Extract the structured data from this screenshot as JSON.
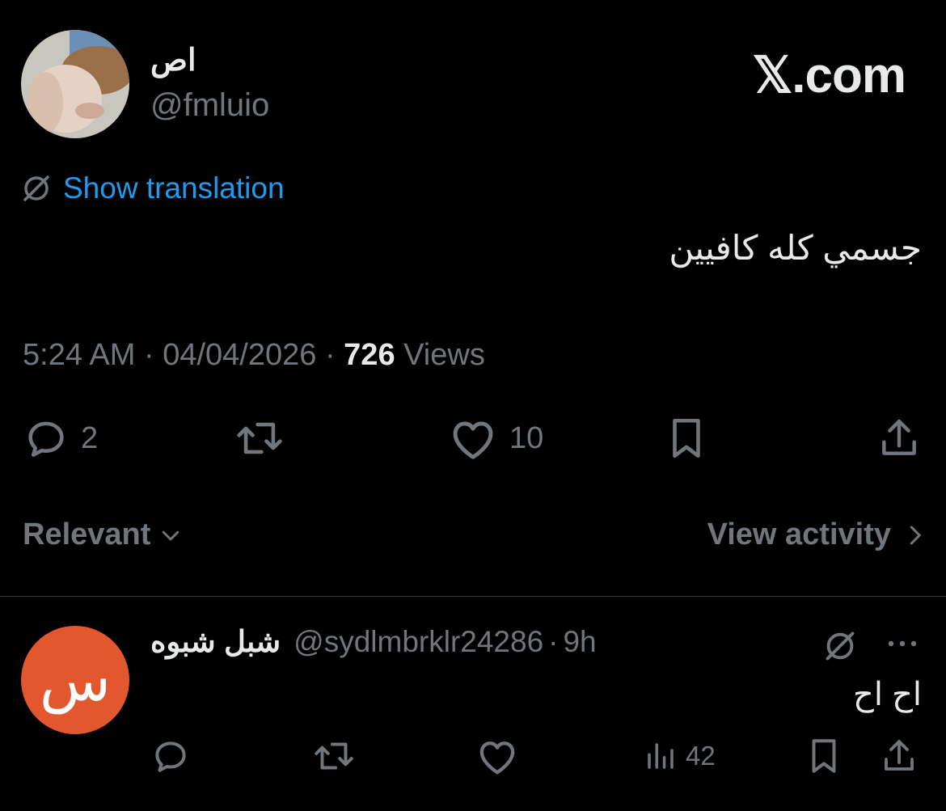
{
  "brand": {
    "text": "𝕏.com"
  },
  "tweet": {
    "author_name": "اص",
    "author_handle": "@fmluio",
    "translate_label": "Show translation",
    "text": "جسمي كله كافيين",
    "time": "5:24 AM",
    "date": "04/04/2026",
    "views_count": "726",
    "views_label": "Views",
    "separator": "·",
    "replies": "2",
    "likes": "10"
  },
  "sort": {
    "label": "Relevant"
  },
  "activity": {
    "label": "View activity"
  },
  "reply": {
    "avatar_letter": "س",
    "author_name": "شبل شبوه",
    "author_handle": "@sydlmbrklr24286",
    "separator": "·",
    "age": "9h",
    "text": "اح اح",
    "views": "42"
  },
  "colors": {
    "background": "#000000",
    "text": "#e7e9ea",
    "muted": "#71767b",
    "link": "#1d9bf0",
    "reply_avatar": "#e3572e"
  }
}
